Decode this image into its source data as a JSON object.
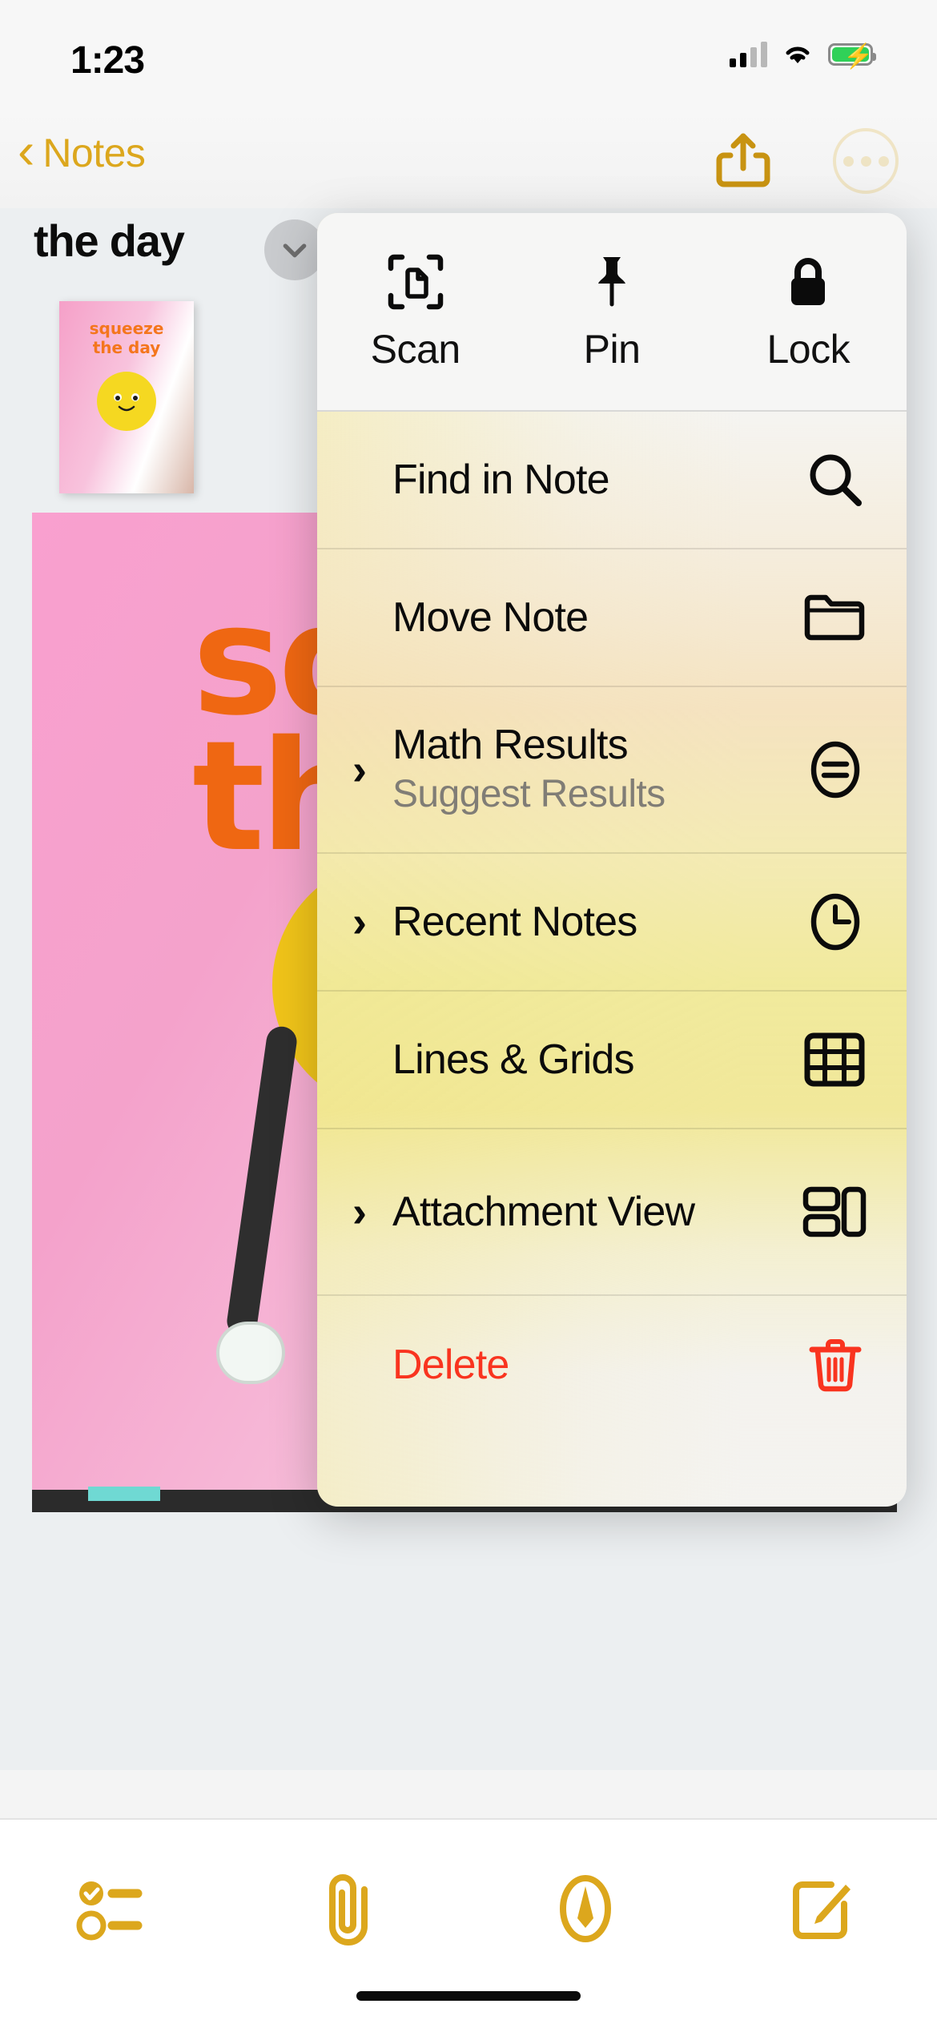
{
  "status_bar": {
    "time": "1:23",
    "cellular_icon": "cellular-bars-icon",
    "wifi_icon": "wifi-icon",
    "battery_icon": "battery-charging-icon"
  },
  "nav_bar": {
    "back_label": "Notes",
    "back_icon": "chevron-left-icon",
    "title": "",
    "share_icon": "share-icon",
    "more_icon": "ellipsis-circle-icon",
    "accent_color": "#DCA71D"
  },
  "note": {
    "title": "the day",
    "collapse_icon": "chevron-down-icon",
    "thumbnail_line1": "squeeze",
    "thumbnail_line2": "the  day",
    "cover_text": "squ\nthe"
  },
  "context_menu": {
    "actions": [
      {
        "label": "Scan",
        "icon": "scan-document-icon"
      },
      {
        "label": "Pin",
        "icon": "pin-icon"
      },
      {
        "label": "Lock",
        "icon": "lock-icon"
      }
    ],
    "items": [
      {
        "label": "Find in Note",
        "sublabel": "",
        "icon": "search-icon",
        "has_submenu": false,
        "destructive": false
      },
      {
        "label": "Move Note",
        "sublabel": "",
        "icon": "folder-icon",
        "has_submenu": false,
        "destructive": false
      },
      {
        "label": "Math Results",
        "sublabel": "Suggest Results",
        "icon": "equals-circle-icon",
        "has_submenu": true,
        "destructive": false
      },
      {
        "label": "Recent Notes",
        "sublabel": "",
        "icon": "clock-icon",
        "has_submenu": true,
        "destructive": false
      },
      {
        "label": "Lines & Grids",
        "sublabel": "",
        "icon": "grid-icon",
        "has_submenu": false,
        "destructive": false
      },
      {
        "label": "Attachment View",
        "sublabel": "",
        "icon": "attachment-view-icon",
        "has_submenu": true,
        "destructive": false
      },
      {
        "label": "Delete",
        "sublabel": "",
        "icon": "trash-icon",
        "has_submenu": false,
        "destructive": true
      }
    ],
    "destructive_color": "#F9341F",
    "submenu_chevron": "chevron-right-icon"
  },
  "bottom_toolbar": {
    "buttons": [
      {
        "name": "checklist",
        "icon": "checklist-icon"
      },
      {
        "name": "attach",
        "icon": "paperclip-icon"
      },
      {
        "name": "markup",
        "icon": "markup-pen-icon"
      },
      {
        "name": "compose",
        "icon": "compose-icon"
      }
    ],
    "accent_color": "#DCA71D"
  }
}
